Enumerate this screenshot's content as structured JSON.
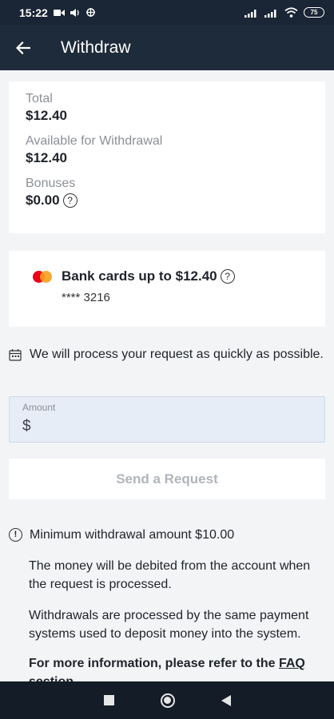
{
  "status_bar": {
    "time": "15:22",
    "battery": "75"
  },
  "header": {
    "title": "Withdraw"
  },
  "balance": {
    "total_label": "Total",
    "total_value": "$12.40",
    "available_label": "Available for Withdrawal",
    "available_value": "$12.40",
    "bonuses_label": "Bonuses",
    "bonuses_value": "$0.00"
  },
  "payment_method": {
    "title": "Bank cards up to $12.40",
    "card_number": "**** 3216"
  },
  "notice": {
    "text": "We will process your request as quickly as possible."
  },
  "amount": {
    "label": "Amount",
    "currency": "$",
    "value": ""
  },
  "send_button": {
    "label": "Send a Request"
  },
  "info": {
    "minimum": "Minimum withdrawal amount $10.00",
    "debit_note": "The money will be debited from the account when the request is processed.",
    "systems_note": "Withdrawals are processed by the same payment systems used to deposit money into the system.",
    "more_info": "For more information, please refer to the ",
    "faq_link": "FAQ",
    "more_info_tail": " section."
  },
  "icons": {
    "back": "arrow-left-icon",
    "help": "question-circle-icon",
    "calendar": "calendar-icon",
    "alert": "exclamation-circle-icon",
    "card_brand": "mastercard-icon"
  }
}
